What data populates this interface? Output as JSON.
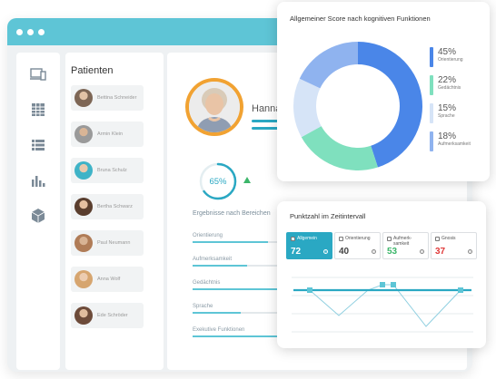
{
  "window": {
    "titlebar_color": "#5ec5d6"
  },
  "rail": {
    "icons": [
      "devices-icon",
      "table-icon",
      "list-icon",
      "bar-chart-icon",
      "box-icon"
    ]
  },
  "patients": {
    "title": "Patienten",
    "items": [
      {
        "name": "Bettina Schneider"
      },
      {
        "name": "Armin Klein"
      },
      {
        "name": "Bruna Schulz"
      },
      {
        "name": "Bertha Schwarz"
      },
      {
        "name": "Paul Neumann"
      },
      {
        "name": "Anna Wolf"
      },
      {
        "name": "Ede Schröder"
      }
    ]
  },
  "profile": {
    "name": "Hanna",
    "score_label": "65%",
    "score_fraction": 0.65,
    "trend": "up",
    "results_title": "Ergebnisse nach Bereichen",
    "results": [
      {
        "label": "Orientierung",
        "fraction": 0.55
      },
      {
        "label": "Aufmerksamkeit",
        "fraction": 0.4
      },
      {
        "label": "Gedächtnis",
        "fraction": 0.72
      },
      {
        "label": "Sprache",
        "fraction": 0.35
      },
      {
        "label": "Exekutive Funktionen",
        "fraction": 0.65
      }
    ]
  },
  "donut_card": {
    "title": "Allgemeiner Score nach kognitiven Funktionen",
    "legend": [
      {
        "value": "45%",
        "name": "Orientierung",
        "color": "#4a86e8"
      },
      {
        "value": "22%",
        "name": "Gedächtnis",
        "color": "#7fe0be"
      },
      {
        "value": "15%",
        "name": "Sprache",
        "color": "#d6e4f7"
      },
      {
        "value": "18%",
        "name": "Aufmerksamkeit",
        "color": "#8fb3ef"
      }
    ]
  },
  "chart_data": {
    "type": "pie",
    "title": "Allgemeiner Score nach kognitiven Funktionen",
    "categories": [
      "Orientierung",
      "Gedächtnis",
      "Sprache",
      "Aufmerksamkeit"
    ],
    "values": [
      45,
      22,
      15,
      18
    ],
    "colors": [
      "#4a86e8",
      "#7fe0be",
      "#d6e4f7",
      "#8fb3ef"
    ]
  },
  "time_card": {
    "title": "Punktzahl im Zeitintervall",
    "tabs": [
      {
        "label": "Allgemein",
        "value": "72",
        "value_color": "#ffffff",
        "active": true,
        "checked": true
      },
      {
        "label": "Orientierung",
        "value": "40",
        "value_color": "#444444",
        "active": false,
        "checked": false
      },
      {
        "label": "Aufmerk-\nsamkeit",
        "value": "53",
        "value_color": "#3cb66a",
        "active": false,
        "checked": false
      },
      {
        "label": "Gnosis",
        "value": "37",
        "value_color": "#e03a3a",
        "active": false,
        "checked": false
      }
    ],
    "info_glyph": "?",
    "check_glyph": "✓"
  },
  "colors": {
    "accent": "#2aa8c3",
    "photo_ring": "#f1a232",
    "trend_up": "#3cb66a"
  }
}
